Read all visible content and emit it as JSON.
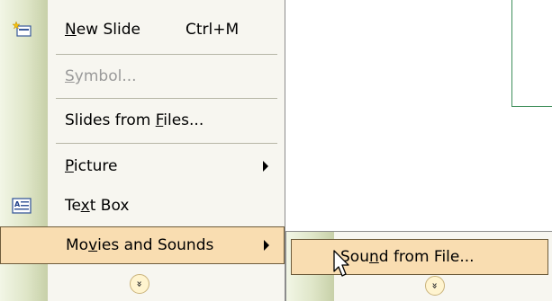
{
  "menu": {
    "items": [
      {
        "pre": "",
        "key": "N",
        "post": "ew Slide",
        "shortcut": "Ctrl+M",
        "icon": "new-slide-icon"
      },
      {
        "pre": "",
        "key": "S",
        "post": "ymbol...",
        "disabled": true
      },
      {
        "pre": "Slides from ",
        "key": "F",
        "post": "iles..."
      },
      {
        "pre": "",
        "key": "P",
        "post": "icture",
        "submenu": true
      },
      {
        "pre": "Te",
        "key": "x",
        "post": "t Box",
        "icon": "text-box-icon"
      },
      {
        "pre": "Mo",
        "key": "v",
        "post": "ies and Sounds",
        "submenu": true,
        "highlighted": true
      }
    ],
    "expand_glyph": "»"
  },
  "submenu": {
    "items": [
      {
        "pre": "Sou",
        "key": "n",
        "post": "d from File...",
        "highlighted": true
      }
    ],
    "expand_glyph": "»"
  },
  "colors": {
    "highlight": "#f9ddb1",
    "highlight_border": "#6e5c3b",
    "menu_bg": "#f7f6f0",
    "gutter": "#dfe6c8"
  }
}
